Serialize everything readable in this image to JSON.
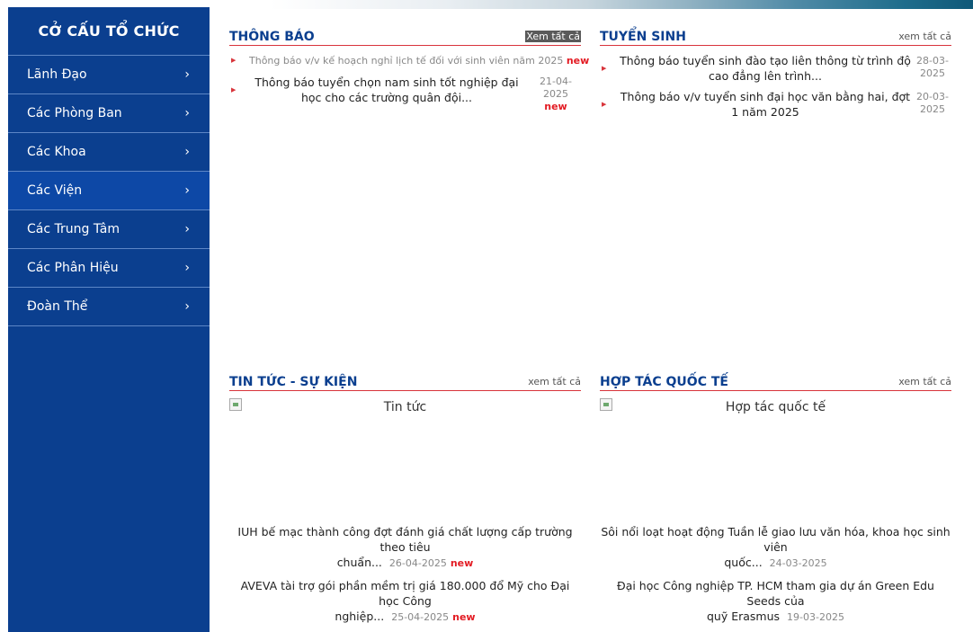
{
  "sidebar": {
    "title": "CỞ CẤU TỔ CHỨC",
    "items": [
      {
        "label": "Lãnh Đạo",
        "chevron": "›"
      },
      {
        "label": "Các Phòng Ban",
        "chevron": "›"
      },
      {
        "label": "Các Khoa",
        "chevron": "›"
      },
      {
        "label": "Các Viện",
        "chevron": "›"
      },
      {
        "label": "Các Trung Tâm",
        "chevron": "›"
      },
      {
        "label": "Các Phân Hiệu",
        "chevron": "›"
      },
      {
        "label": "Đoàn Thể",
        "chevron": "›"
      }
    ]
  },
  "thongbao": {
    "title": "THÔNG BÁO",
    "link": "Xem tất cả",
    "items": [
      {
        "text": "Thông báo v/v kế hoạch nghỉ lịch tế đối với sinh viên năm 2025",
        "badge": "new"
      },
      {
        "text": "Thông báo tuyển chọn nam sinh tốt nghiệp đại học cho các trường quân đội...",
        "date": "21-04-2025",
        "badge": "new"
      }
    ]
  },
  "tuyensinh": {
    "title": "TUYỂN SINH",
    "link": "xem tất cả",
    "items": [
      {
        "text": "Thông báo tuyển sinh đào tạo liên thông từ trình độ cao đẳng lên trình...",
        "date_a": "28-03-",
        "date_b": "2025"
      },
      {
        "text": "Thông báo v/v tuyển sinh đại học văn bằng hai, đợt 1 năm 2025",
        "date_a": "20-03-",
        "date_b": "2025"
      }
    ]
  },
  "tintuc": {
    "title": "TIN TỨC - SỰ KIỆN",
    "link": "xem tất cả",
    "image_alt": "Tin tức",
    "items": [
      {
        "line1": "IUH bế mạc thành công đợt đánh giá chất lượng cấp trường theo tiêu",
        "line2": "chuẩn...",
        "date": "26-04-2025",
        "badge": "new"
      },
      {
        "line1": "AVEVA tài trợ gói phần mềm trị giá 180.000 đổ Mỹ cho Đại học Công",
        "line2": "nghiệp...",
        "date": "25-04-2025",
        "badge": "new"
      }
    ]
  },
  "hoptac": {
    "title": "HỢP TÁC QUỐC TẾ",
    "link": "xem tất cả",
    "image_alt": "Hợp tác quốc tế",
    "items": [
      {
        "line1": "Sôi nổi loạt hoạt động Tuần lễ giao lưu văn hóa, khoa học sinh viên",
        "line2": "quốc...",
        "date": "24-03-2025"
      },
      {
        "line1": "Đại học Công nghiệp TP. HCM tham gia dự án Green Edu Seeds của",
        "line2": "quỹ Erasmus",
        "date": "19-03-2025"
      }
    ]
  }
}
